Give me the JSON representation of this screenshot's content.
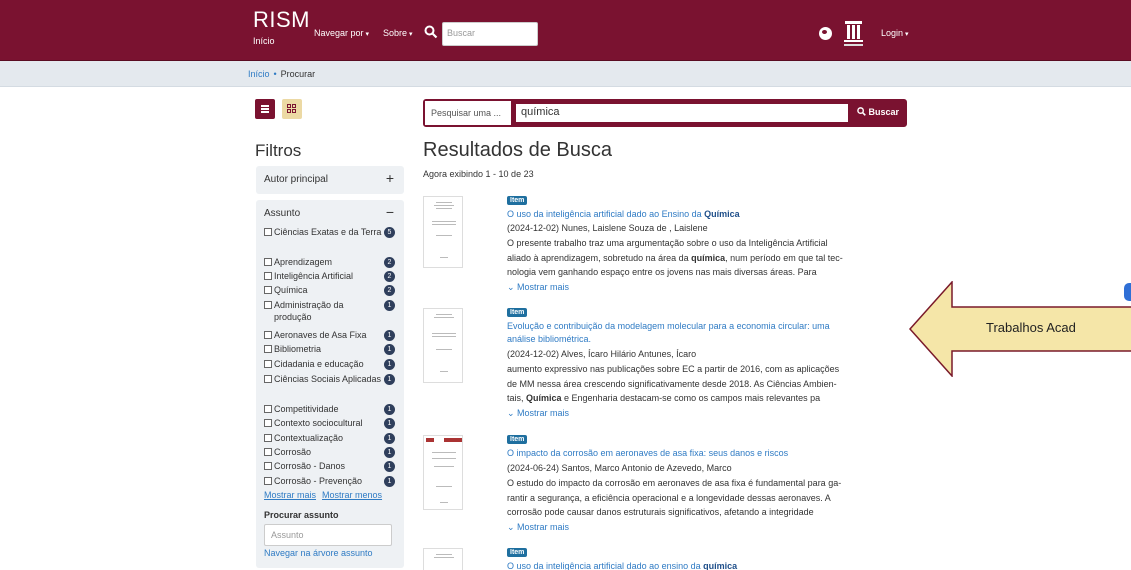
{
  "header": {
    "brand": "RISM",
    "brand_sub": "Início",
    "nav": {
      "browse": "Navegar por",
      "about": "Sobre"
    },
    "search_placeholder": "Buscar",
    "login": "Login"
  },
  "breadcrumb": {
    "home": "Início",
    "sep": "•",
    "current": "Procurar"
  },
  "filters": {
    "title": "Filtros",
    "autor_label": "Autor principal",
    "assunto_label": "Assunto",
    "facets": [
      {
        "label": "Ciências Exatas e da Terra",
        "count": "5"
      },
      {
        "label": "Aprendizagem",
        "count": "2"
      },
      {
        "label": "Inteligência Artificial",
        "count": "2"
      },
      {
        "label": "Química",
        "count": "2"
      },
      {
        "label": "Administração da produção",
        "count": "1"
      },
      {
        "label": "Aeronaves de Asa Fixa",
        "count": "1"
      },
      {
        "label": "Bibliometria",
        "count": "1"
      },
      {
        "label": "Cidadania e educação",
        "count": "1"
      },
      {
        "label": "Ciências Sociais Aplicadas",
        "count": "1"
      },
      {
        "label": "Competitividade",
        "count": "1"
      },
      {
        "label": "Contexto sociocultural",
        "count": "1"
      },
      {
        "label": "Contextualização",
        "count": "1"
      },
      {
        "label": "Corrosão",
        "count": "1"
      },
      {
        "label": "Corrosão - Danos",
        "count": "1"
      },
      {
        "label": "Corrosão - Prevenção",
        "count": "1"
      }
    ],
    "more": "Mostrar mais",
    "less": "Mostrar menos",
    "procurar_label": "Procurar assunto",
    "assunto_placeholder": "Assunto",
    "arvore_link": "Navegar na árvore assunto"
  },
  "search": {
    "type_label": "Pesquisar uma ...",
    "query": "química",
    "button": "Buscar"
  },
  "results": {
    "title": "Resultados de Busca",
    "count": "Agora exibindo 1 - 10 de 23",
    "badge": "Item",
    "more": "Mostrar mais",
    "items": [
      {
        "title_a": "O uso da inteligência artificial dado ao Ensino da ",
        "title_b": "Química",
        "meta": "(2024-12-02) Nunes, Laislene Souza de , Laislene",
        "abs1": "O presente trabalho traz uma argumentação sobre o uso da Inteligência Artificial",
        "abs2a": "aliado à aprendizagem, sobretudo na área da ",
        "abs2b": "química",
        "abs2c": ", num período em que tal tec-",
        "abs3": "nologia vem ganhando espaço entre os jovens nas mais diversas áreas. Para"
      },
      {
        "title_a": "Evolução e contribuição da modelagem molecular para a economia circular: uma análise bibliométrica.",
        "meta": "(2024-12-02) Alves, Ícaro Hilário Antunes, Ícaro",
        "abs1": "aumento expressivo nas publicações sobre EC a partir de 2016, com as aplicações",
        "abs2": "de MM nessa área crescendo significativamente desde 2018. As Ciências Ambien-",
        "abs3a": "tais, ",
        "abs3b": "Química",
        "abs3c": " e Engenharia destacam-se como os campos mais relevantes pa"
      },
      {
        "title_a": "O impacto da corrosão em aeronaves de asa fixa: seus danos e riscos",
        "meta": "(2024-06-24) Santos, Marco Antonio de Azevedo, Marco",
        "abs1": "O estudo do impacto da corrosão em aeronaves de asa fixa é fundamental para ga-",
        "abs2": "rantir a segurança, a eficiência operacional e a longevidade dessas aeronaves. A",
        "abs3": "corrosão pode causar danos estruturais significativos, afetando a integridade"
      },
      {
        "title_a": "O uso da inteligência artificial dado ao ensino da ",
        "title_b": "química"
      }
    ]
  },
  "callout": {
    "text": "Trabalhos Acad"
  }
}
